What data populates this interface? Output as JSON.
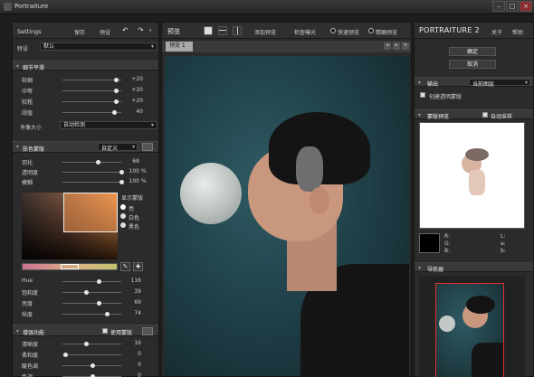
{
  "window": {
    "title": "Portraiture"
  },
  "left": {
    "header": {
      "title": "Settings",
      "save": "保存",
      "preset": "预设",
      "undo_arrow": "↶",
      "redo_arrow": "↷"
    },
    "preset": {
      "label": "特设",
      "value": "默认"
    },
    "detail": {
      "title": "细节平滑",
      "sliders": [
        {
          "label": "较细",
          "value": "+20",
          "knob": 0.9
        },
        {
          "label": "中等",
          "value": "+20",
          "knob": 0.9
        },
        {
          "label": "较粗",
          "value": "+20",
          "knob": 0.9
        },
        {
          "label": "阈值",
          "value": "40",
          "knob": 0.88
        }
      ],
      "portrait_size_label": "肖像大小",
      "portrait_size_value": "自动检测"
    },
    "skin": {
      "title": "肤色蒙版",
      "mode": "自定义",
      "sliders": [
        {
          "label": "羽化",
          "value": "68",
          "unit": "",
          "knob": 0.6
        },
        {
          "label": "透明度",
          "value": "100",
          "unit": "%",
          "knob": 1.0
        },
        {
          "label": "模糊",
          "value": "100",
          "unit": "%",
          "knob": 1.0
        }
      ],
      "show_mask_label": "显示蒙版",
      "radio": [
        "亮",
        "白色",
        "黑色"
      ],
      "hsl": [
        {
          "label": "Hue",
          "value": "116",
          "knob": 0.62
        },
        {
          "label": "饱和度",
          "value": "39",
          "knob": 0.4
        },
        {
          "label": "亮度",
          "value": "69",
          "knob": 0.62
        },
        {
          "label": "纵度",
          "value": "74",
          "knob": 0.75
        }
      ]
    },
    "enhance": {
      "title": "增强功能",
      "use_mask": "使用蒙版",
      "sliders": [
        {
          "label": "清晰度",
          "value": "16",
          "knob": 0.4
        },
        {
          "label": "柔和度",
          "value": "0",
          "knob": 0.05
        },
        {
          "label": "暖色调",
          "value": "0",
          "knob": 0.5
        },
        {
          "label": "色调",
          "value": "0",
          "knob": 0.5
        },
        {
          "label": "亮度",
          "value": "-6",
          "knob": 0.48
        }
      ]
    }
  },
  "center": {
    "title": "预览",
    "buttons": [
      "添加预览",
      "检查曝光"
    ],
    "radios": [
      "快速预览",
      "精确预览"
    ],
    "tab": "预览 1"
  },
  "right": {
    "brand": "PORTRAITURE 2",
    "about": "关于",
    "help": "帮助",
    "ok": "确定",
    "cancel": "取消",
    "output": {
      "title": "输出",
      "value": "当前图层",
      "checkbox": "创建透明蒙版"
    },
    "mask_preview": {
      "title": "蒙版预览",
      "auto_sample": "自动采样"
    },
    "channels": [
      "R:",
      "G:",
      "B:",
      "L:",
      "a:",
      "b:"
    ],
    "navigator": {
      "title": "导航器"
    }
  }
}
